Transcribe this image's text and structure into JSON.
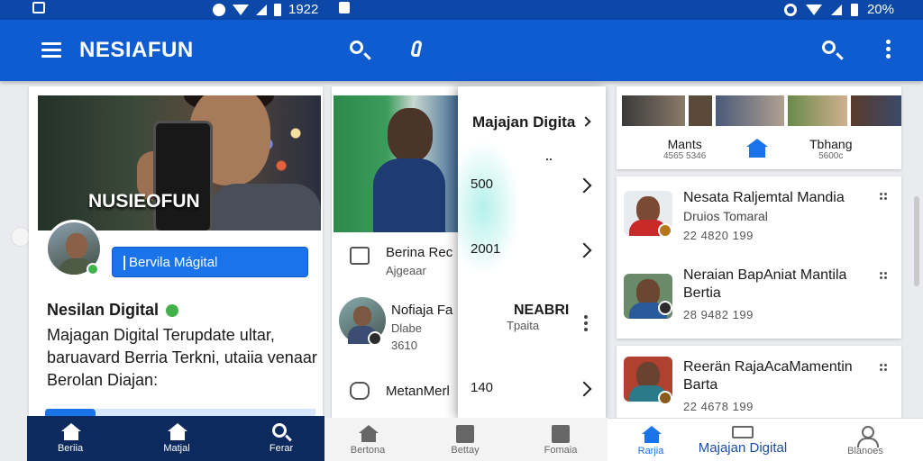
{
  "statusbar": {
    "left_time": "1922",
    "right_battery": "20%"
  },
  "appbar": {
    "title": "NESIAFUN"
  },
  "card1": {
    "hero_caption": "NUSIEOFUN",
    "input_value": "Bervila Mágital",
    "name": "Nesilan Digital",
    "description": "Majagan Digital Terupdate ultar, baruavard Berria Terkni, utaiia venaar Berolan Diajan:"
  },
  "card2": {
    "row1_title": "Berina Rec",
    "row1_sub": "Ajgeaar",
    "row2_title": "Nofiaja Fa",
    "row2_sub": "Dlabe",
    "row2_time": "3610",
    "row3_title": "MetanMerl"
  },
  "panel": {
    "title": "Majajan Digita",
    "rows": [
      {
        "value": "500"
      },
      {
        "value": "2001"
      },
      {
        "value": "140"
      }
    ],
    "mid_title": "NEABRI",
    "mid_sub": "Tpaita"
  },
  "card4": {
    "tab_left": "Mants",
    "tab_left_sub": "4565 5346",
    "tab_right": "Tbhang",
    "tab_right_sub": "5600c"
  },
  "list": {
    "items": [
      {
        "title": "Nesata Raljemtal Mandia",
        "sub": "Druios Tomaral",
        "time": "22 4820 199"
      },
      {
        "title": "Neraian BapAniat Mantila Bertia",
        "sub": "",
        "time": "28 9482 199"
      },
      {
        "title": "Reerän RajaAcaMamentin Barta",
        "sub": "",
        "time": "22 4678 199"
      }
    ]
  },
  "nav": {
    "dark": [
      {
        "label": "Beriia"
      },
      {
        "label": "Matjal"
      },
      {
        "label": "Ferar"
      }
    ],
    "light": [
      {
        "label": "Bertona"
      },
      {
        "label": "Bettay"
      },
      {
        "label": "Fomaia"
      }
    ],
    "white": [
      {
        "label": "Rarjia"
      },
      {
        "label": "Majajan Digital"
      },
      {
        "label": "Blanoes"
      }
    ]
  },
  "colors": {
    "primary": "#0f5bd0",
    "status": "#0b48a8",
    "nav_dark": "#0c2a5e",
    "accent": "#1a73e8",
    "online": "#3fb54a"
  }
}
